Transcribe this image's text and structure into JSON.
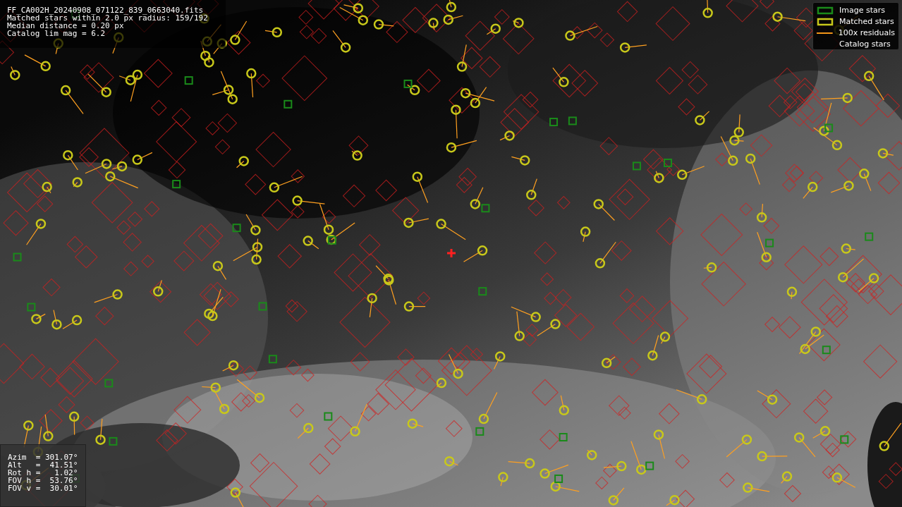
{
  "info_box": {
    "lines": [
      "FF_CA002H_20240908_071122_839_0663040.fits",
      "Matched stars within 2.0 px radius: 159/192",
      "Median distance = 0.20 px",
      "Catalog lim mag = 6.2"
    ]
  },
  "legend": [
    {
      "label": "Image stars",
      "kind": "box",
      "color": "#1a8a1a"
    },
    {
      "label": "Matched stars",
      "kind": "box",
      "color": "#c8c81a"
    },
    {
      "label": "100x residuals",
      "kind": "line",
      "color": "#ff9f1a"
    },
    {
      "label": "Catalog stars",
      "kind": "none"
    }
  ],
  "pointing_box": {
    "lines": [
      "Azim  = 301.07°",
      "Alt   =  41.51°",
      "Rot h =   1.02°",
      "FOV h =  53.76°",
      "FOV v =  30.01°"
    ]
  }
}
